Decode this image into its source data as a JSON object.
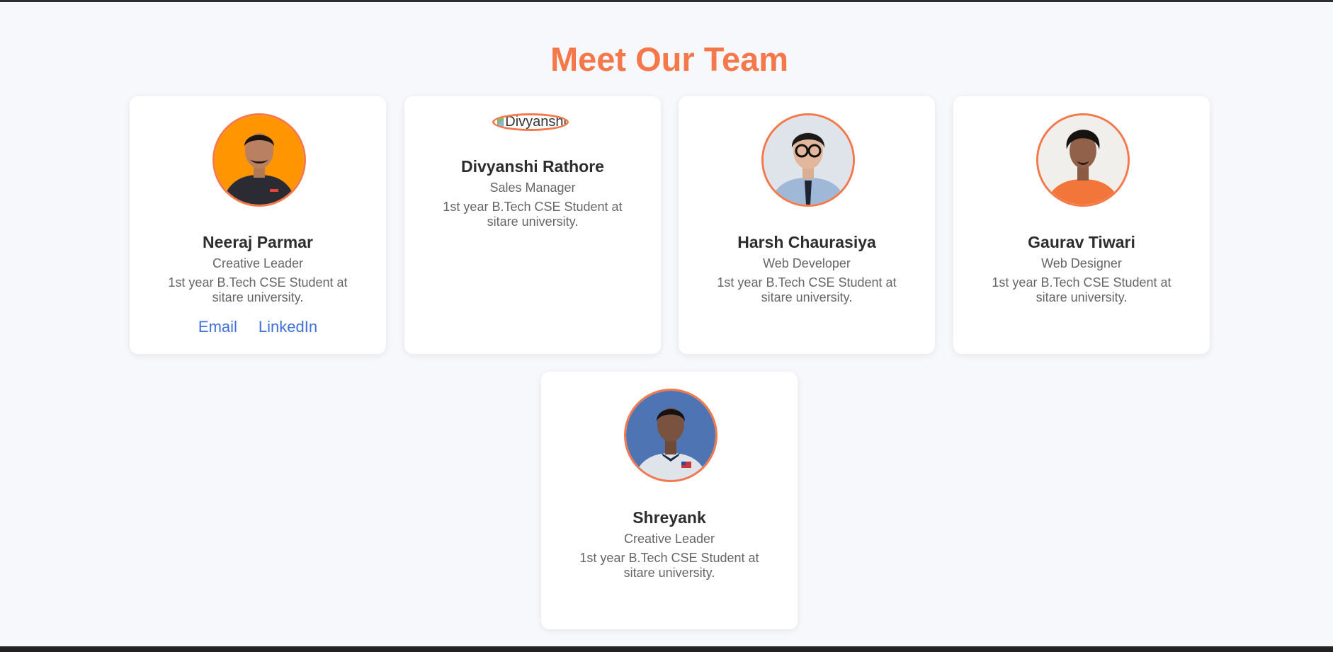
{
  "page": {
    "title": "Meet Our Team",
    "accent_color": "#f4784a",
    "link_color": "#3f6fd8"
  },
  "team": [
    {
      "name": "Neeraj Parmar",
      "role": "Creative Leader",
      "description": "1st year B.Tech CSE Student at sitare university.",
      "links": {
        "email": "Email",
        "linkedin": "LinkedIn"
      },
      "photo": "avatar-orange-background"
    },
    {
      "name": "Divyanshi Rathore",
      "role": "Sales Manager",
      "description": "1st year B.Tech CSE Student at sitare university.",
      "image_alt": "Divyanshi",
      "photo": "broken-image"
    },
    {
      "name": "Harsh Chaurasiya",
      "role": "Web Developer",
      "description": "1st year B.Tech CSE Student at sitare university.",
      "photo": "avatar-light-background"
    },
    {
      "name": "Gaurav Tiwari",
      "role": "Web Designer",
      "description": "1st year B.Tech CSE Student at sitare university.",
      "photo": "avatar-white-background"
    },
    {
      "name": "Shreyank",
      "role": "Creative Leader",
      "description": "1st year B.Tech CSE Student at sitare university.",
      "photo": "avatar-blue-background"
    }
  ]
}
